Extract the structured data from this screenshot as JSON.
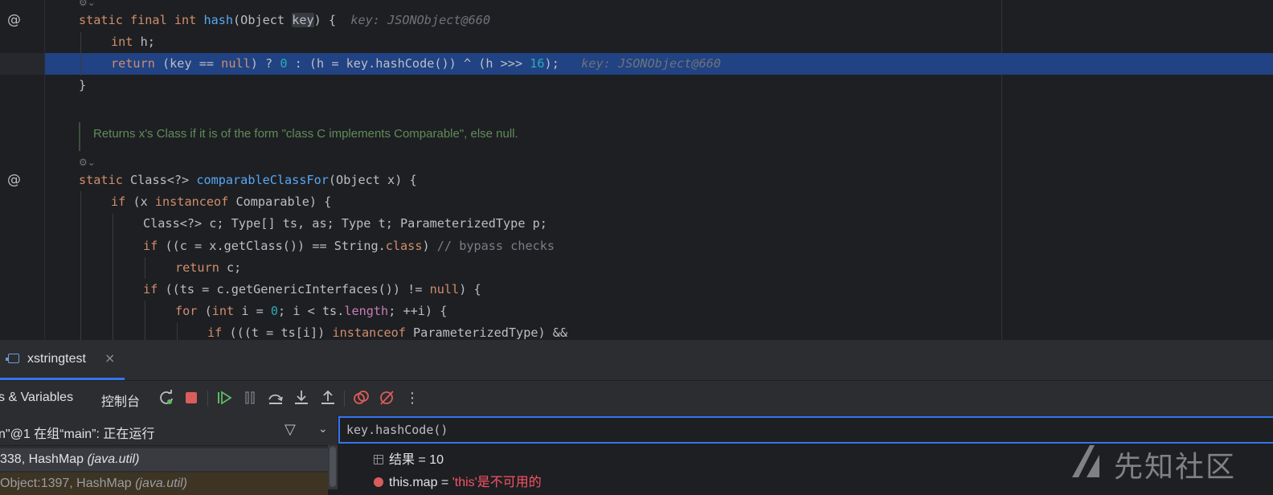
{
  "editor": {
    "lines": {
      "hash_sig": {
        "kw1": "static final int ",
        "fn": "hash",
        "p1": "(Object ",
        "key": "key",
        "p2": ") {",
        "hint": "key: JSONObject@660"
      },
      "int_h": {
        "kw": "int",
        "rest": " h;"
      },
      "ret": {
        "kw": "return",
        "a": " (key == ",
        "null": "null",
        "b": ") ? ",
        "zero": "0",
        "c": " : (h = ",
        "sel": "key.hashCode()",
        "d": ") ^ (h >>> ",
        "sixteen": "16",
        "e": ");",
        "hint": "key: JSONObject@660"
      },
      "close1": "}",
      "doc": "Returns x's Class if it is of the form \"class C implements Comparable\", else null.",
      "ccf_sig": {
        "kw": "static ",
        "t": "Class<?> ",
        "fn": "comparableClassFor",
        "rest": "(Object x) {"
      },
      "if1": {
        "kw": "if",
        "a": " (x ",
        "kw2": "instanceof",
        "b": " Comparable) {"
      },
      "decl": "Class<?> c; Type[] ts, as; Type t; ParameterizedType p;",
      "if2": {
        "kw": "if",
        "a": " ((c = x.getClass()) == String.",
        "kw2": "class",
        "b": ") ",
        "cmt": "// bypass checks"
      },
      "ret_c": {
        "kw": "return",
        "rest": " c;"
      },
      "if3": {
        "kw": "if",
        "a": " ((ts = c.getGenericInterfaces()) != ",
        "kw2": "null",
        "b": ") {"
      },
      "for1": {
        "kw": "for",
        "a": " (",
        "kw2": "int",
        "b": " i = ",
        "zero": "0",
        "c": "; i < ts.",
        "fld": "length",
        "d": "; ++i) {"
      },
      "if4": {
        "kw": "if",
        "a": " (((t = ts[i]) ",
        "kw2": "instanceof",
        "b": " ParameterizedType) &&"
      }
    },
    "gutter_marker": "@"
  },
  "debug": {
    "tab_label": "xstringtest",
    "tab_close": "×",
    "toolbar": {
      "frames_vars_label": "s & Variables",
      "console_label": "控制台",
      "more": "⋮"
    },
    "thread_text": "n\"@1 在组“main”: 正在运行",
    "frames": [
      {
        "prefix": "338, HashMap ",
        "pkg": "(java.util)"
      },
      {
        "prefix": "Object:1397, HashMap ",
        "pkg": "(java.util)"
      }
    ],
    "eval_expression": "key.hashCode()",
    "vars": [
      {
        "name": "结果",
        "eq": " = ",
        "value": "10"
      },
      {
        "name": "this.map",
        "eq": " = ",
        "value": "'this'是不可用的"
      }
    ]
  },
  "watermark": {
    "text": "先知社区"
  },
  "colors": {
    "accent": "#3574f0",
    "selection": "#214283",
    "keyword": "#cf8e6d",
    "function": "#56a8f5",
    "number": "#2aacb8"
  }
}
